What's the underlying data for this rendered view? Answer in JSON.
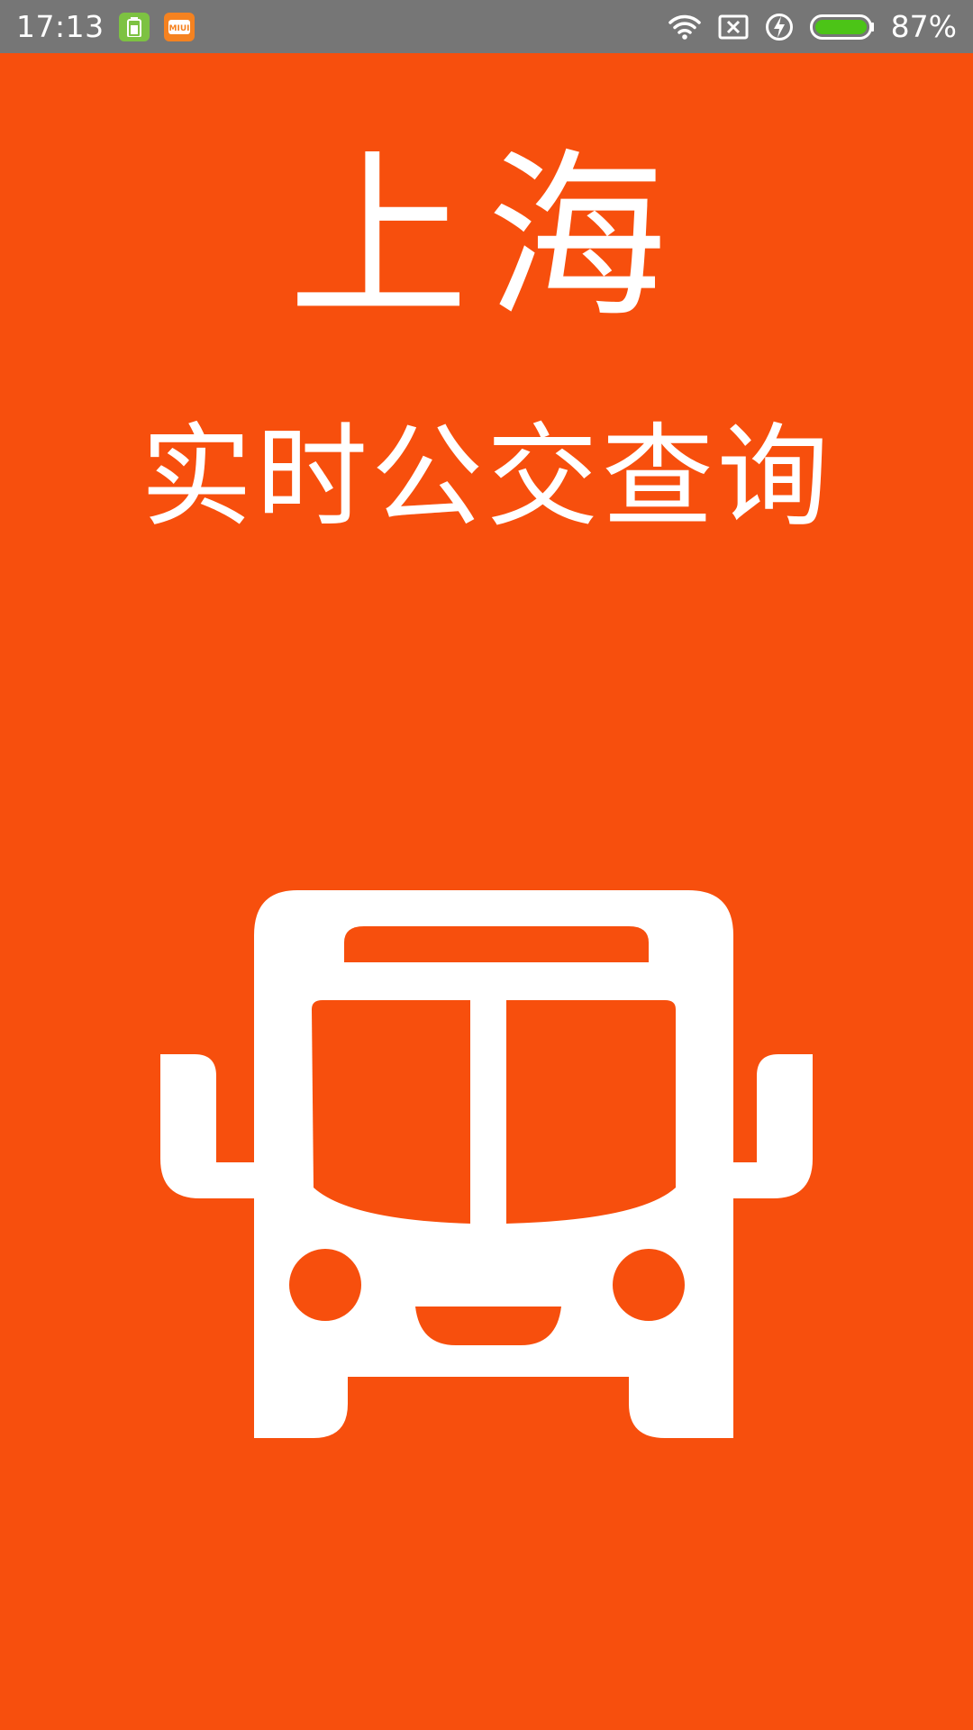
{
  "status_bar": {
    "time": "17:13",
    "battery_percent": "87%",
    "icons": [
      "battery-notification-icon",
      "miui-notification-icon",
      "wifi-icon",
      "no-sim-icon",
      "charging-icon",
      "battery-icon"
    ]
  },
  "splash": {
    "city": "上海",
    "subtitle": "实时公交查询",
    "illustration": "bus-icon"
  },
  "colors": {
    "background": "#F74F0D",
    "status_bar": "#767676",
    "foreground": "#FFFFFF",
    "battery_fill": "#4CC417"
  }
}
